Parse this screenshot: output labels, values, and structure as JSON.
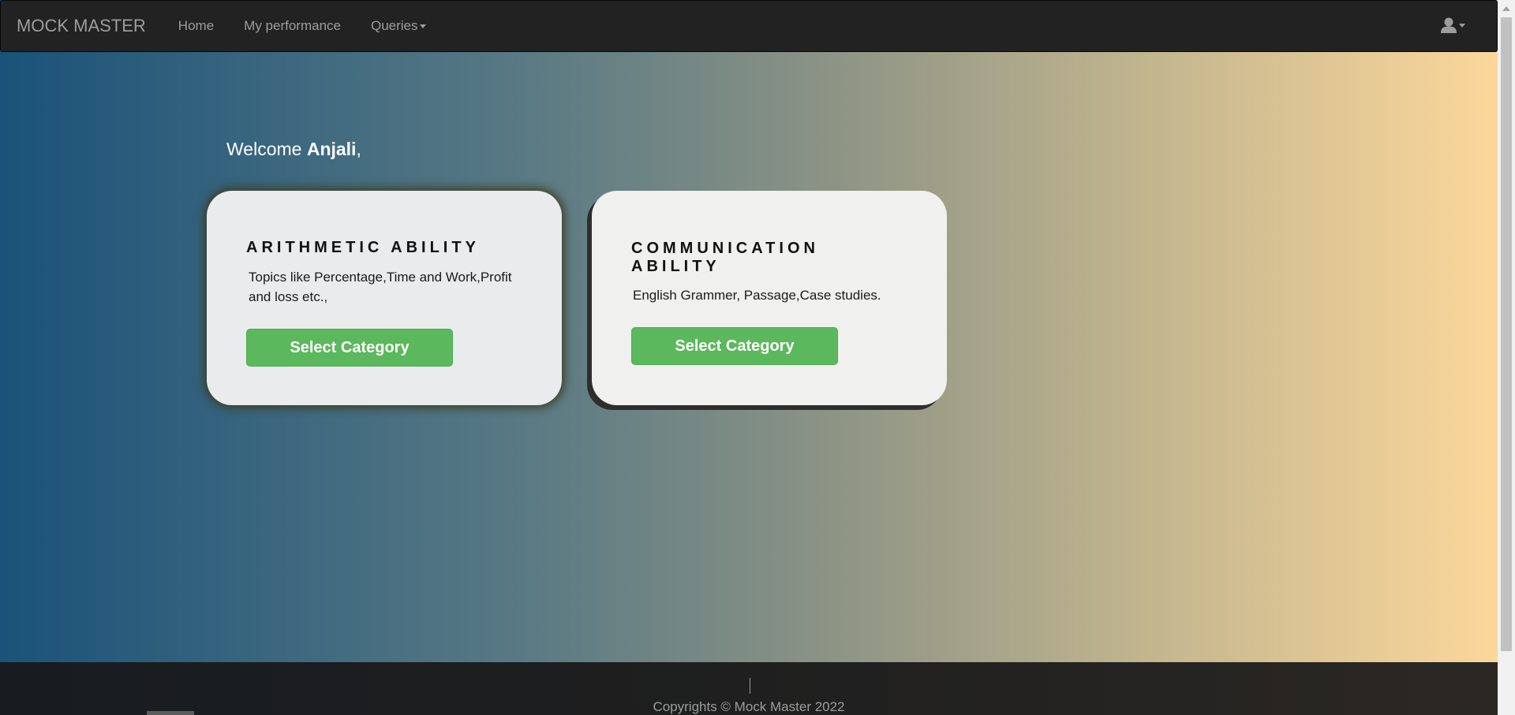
{
  "navbar": {
    "brand": "MOCK MASTER",
    "links": [
      {
        "label": "Home"
      },
      {
        "label": "My performance"
      },
      {
        "label": "Queries"
      }
    ],
    "user_icon": "user-icon"
  },
  "welcome": {
    "prefix": "Welcome ",
    "name": "Anjali",
    "suffix": ","
  },
  "cards": [
    {
      "title": "ARITHMETIC ABILITY",
      "description": "Topics like Percentage,Time and Work,Profit and loss etc.,",
      "button_label": "Select Category"
    },
    {
      "title": "COMMUNICATION ABILITY",
      "description": "English Grammer, Passage,Case studies.",
      "button_label": "Select Category"
    }
  ],
  "footer": {
    "copyright": "Copyrights © Mock Master 2022"
  },
  "colors": {
    "navbar_bg": "#222222",
    "button_green": "#5cb85c",
    "gradient_start": "#1a5279",
    "gradient_end": "#fed99b"
  }
}
